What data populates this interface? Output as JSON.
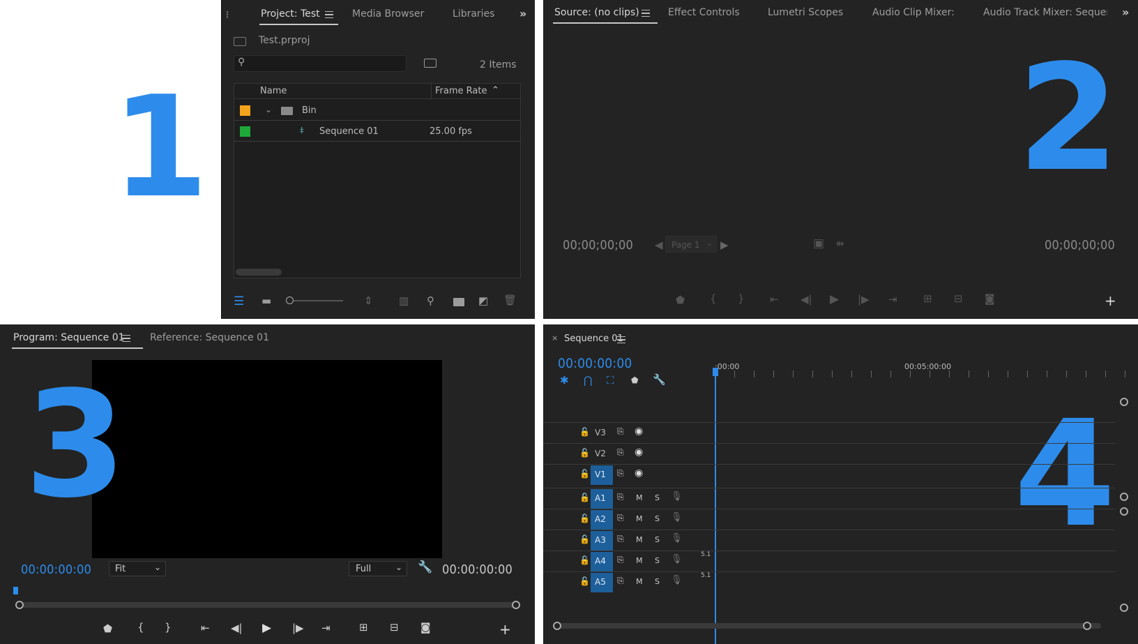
{
  "labels": {
    "n1": "1",
    "n2": "2",
    "n3": "3",
    "n4": "4"
  },
  "project": {
    "tabs": [
      "Project: Test",
      "Media Browser",
      "Libraries"
    ],
    "file": "Test.prproj",
    "item_count": "2 Items",
    "columns": {
      "name": "Name",
      "frame_rate": "Frame Rate"
    },
    "rows": [
      {
        "name": "Bin",
        "frame_rate": "",
        "color": "#f5a31b",
        "icon": "folder-icon"
      },
      {
        "name": "Sequence 01",
        "frame_rate": "25.00 fps",
        "color": "#1fa83a",
        "icon": "sequence-icon"
      }
    ]
  },
  "source": {
    "tabs": [
      "Source: (no clips)",
      "Effect Controls",
      "Lumetri Scopes",
      "Audio Clip Mixer:",
      "Audio Track Mixer: Sequenc"
    ],
    "timecode_left": "00;00;00;00",
    "timecode_right": "00;00;00;00",
    "page": "Page 1"
  },
  "program": {
    "tabs": [
      "Program: Sequence 01",
      "Reference: Sequence 01"
    ],
    "timecode_left": "00:00:00:00",
    "timecode_right": "00:00:00:00",
    "fit": "Fit",
    "quality": "Full"
  },
  "timeline": {
    "tab": "Sequence 01",
    "timecode": "00:00:00:00",
    "ruler": [
      ":00:00",
      "00:05:00:00"
    ],
    "video_tracks": [
      "V3",
      "V2",
      "V1"
    ],
    "audio_tracks": [
      "A1",
      "A2",
      "A3",
      "A4",
      "A5"
    ],
    "mute": "M",
    "solo": "S",
    "channel_label": "5.1"
  }
}
